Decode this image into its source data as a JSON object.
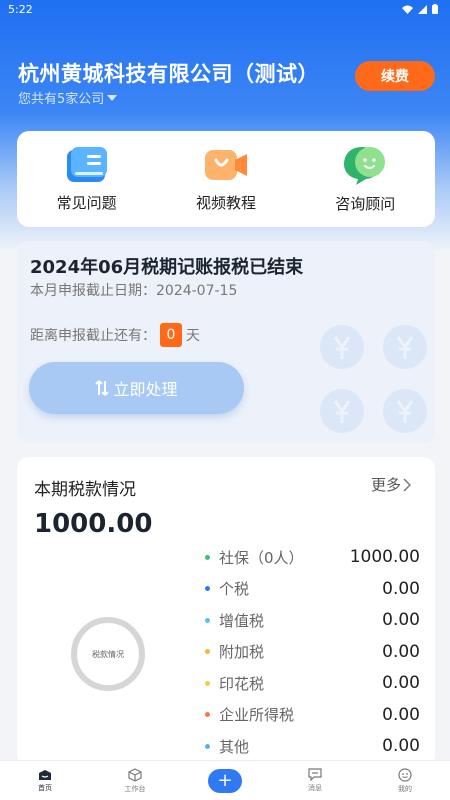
{
  "status": {
    "time": "5:22"
  },
  "header": {
    "company_name": "杭州黄城科技有限公司（测试）",
    "company_count": "您共有5家公司",
    "renew_label": "续费"
  },
  "quick_links": [
    {
      "label": "常见问题",
      "icon": "book-icon"
    },
    {
      "label": "视频教程",
      "icon": "video-camera-icon"
    },
    {
      "label": "咨询顾问",
      "icon": "chat-advisor-icon"
    }
  ],
  "tax_status": {
    "title": "2024年06月税期记账报税已结束",
    "deadline": "本月申报截止日期：2024-07-15",
    "remain_prefix": "距离申报截止还有：",
    "remain_days": "0",
    "remain_suffix": "天",
    "action_label": "立即处理"
  },
  "payments": {
    "title": "本期税款情况",
    "more_label": "更多",
    "total": "1000.00",
    "chart_label": "税款情况",
    "items": [
      {
        "name": "社保（0人）",
        "value": "1000.00",
        "color": "#3cc07a"
      },
      {
        "name": "个税",
        "value": "0.00",
        "color": "#2f7af2"
      },
      {
        "name": "增值税",
        "value": "0.00",
        "color": "#56c1f0"
      },
      {
        "name": "附加税",
        "value": "0.00",
        "color": "#f5b449"
      },
      {
        "name": "印花税",
        "value": "0.00",
        "color": "#f2cf3a"
      },
      {
        "name": "企业所得税",
        "value": "0.00",
        "color": "#f07b4a"
      },
      {
        "name": "其他",
        "value": "0.00",
        "color": "#5bb3e0"
      }
    ]
  },
  "tabbar": {
    "home": "首页",
    "workbench": "工作台",
    "add": "+",
    "messages": "消息",
    "mine": "我的"
  }
}
